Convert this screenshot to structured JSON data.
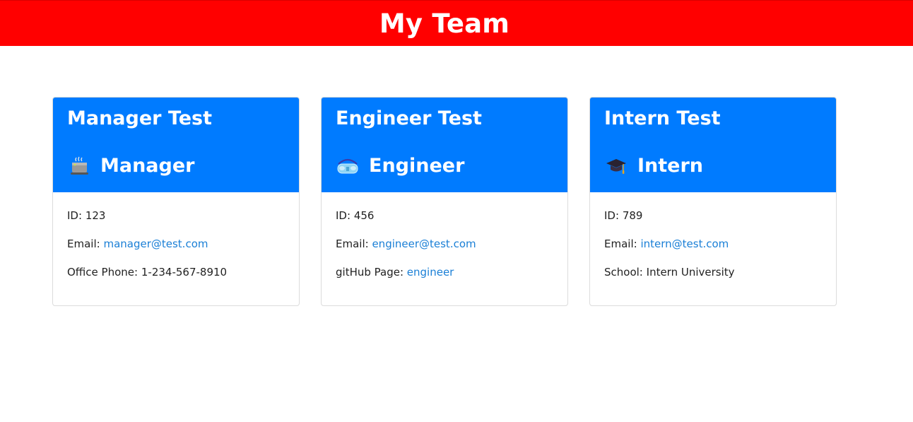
{
  "header": {
    "title": "My Team",
    "color": "#ff0000"
  },
  "theme": {
    "card_header_color": "#007bff",
    "link_color": "#1a7fd6"
  },
  "cards": [
    {
      "name": "Manager Test",
      "role": "Manager",
      "role_icon": "coffee-mug-icon",
      "id_label": "ID:",
      "id_value": "123",
      "email_label": "Email:",
      "email": "manager@test.com",
      "extra_label": "Office Phone:",
      "extra_value": "1-234-567-8910"
    },
    {
      "name": "Engineer Test",
      "role": "Engineer",
      "role_icon": "goggles-icon",
      "id_label": "ID:",
      "id_value": "456",
      "email_label": "Email:",
      "email": "engineer@test.com",
      "extra_label": "gitHub Page:",
      "extra_value": "engineer"
    },
    {
      "name": "Intern Test",
      "role": "Intern",
      "role_icon": "graduation-cap-icon",
      "id_label": "ID:",
      "id_value": "789",
      "email_label": "Email:",
      "email": "intern@test.com",
      "extra_label": "School:",
      "extra_value": "Intern University"
    }
  ]
}
